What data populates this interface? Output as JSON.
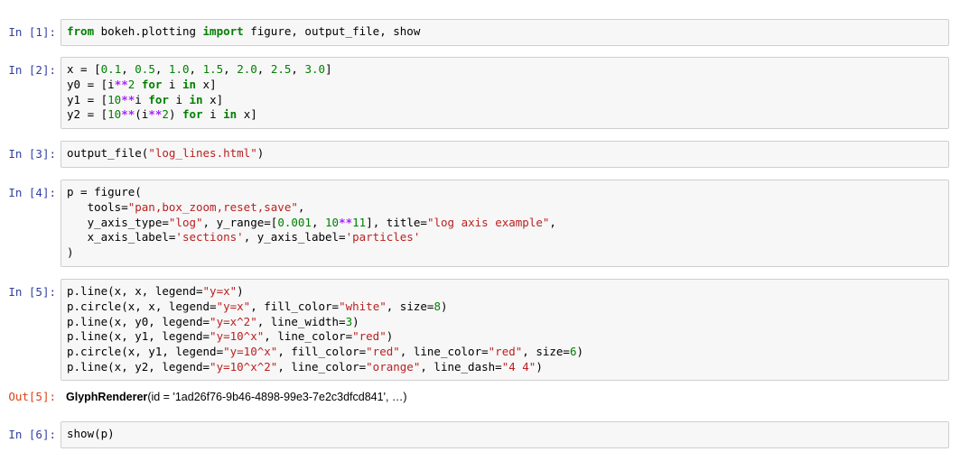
{
  "cells": [
    {
      "prompt": "In [1]:",
      "lines": [
        "from bokeh.plotting import figure, output_file, show"
      ]
    },
    {
      "prompt": "In [2]:",
      "lines": [
        "x = [0.1, 0.5, 1.0, 1.5, 2.0, 2.5, 3.0]",
        "y0 = [i**2 for i in x]",
        "y1 = [10**i for i in x]",
        "y2 = [10**(i**2) for i in x]"
      ]
    },
    {
      "prompt": "In [3]:",
      "lines": [
        "output_file(\"log_lines.html\")"
      ]
    },
    {
      "prompt": "In [4]:",
      "lines": [
        "p = figure(",
        "   tools=\"pan,box_zoom,reset,save\",",
        "   y_axis_type=\"log\", y_range=[0.001, 10**11], title=\"log axis example\",",
        "   x_axis_label='sections', y_axis_label='particles'",
        ")"
      ]
    },
    {
      "prompt": "In [5]:",
      "lines": [
        "p.line(x, x, legend=\"y=x\")",
        "p.circle(x, x, legend=\"y=x\", fill_color=\"white\", size=8)",
        "p.line(x, y0, legend=\"y=x^2\", line_width=3)",
        "p.line(x, y1, legend=\"y=10^x\", line_color=\"red\")",
        "p.circle(x, y1, legend=\"y=10^x\", fill_color=\"red\", line_color=\"red\", size=6)",
        "p.line(x, y2, legend=\"y=10^x^2\", line_color=\"orange\", line_dash=\"4 4\")"
      ],
      "output": {
        "prompt": "Out[5]:",
        "class_name": "GlyphRenderer",
        "text": "(id = '1ad26f76-9b46-4898-99e3-7e2c3dfcd841', …)"
      }
    },
    {
      "prompt": "In [6]:",
      "lines": [
        "show(p)"
      ]
    }
  ]
}
